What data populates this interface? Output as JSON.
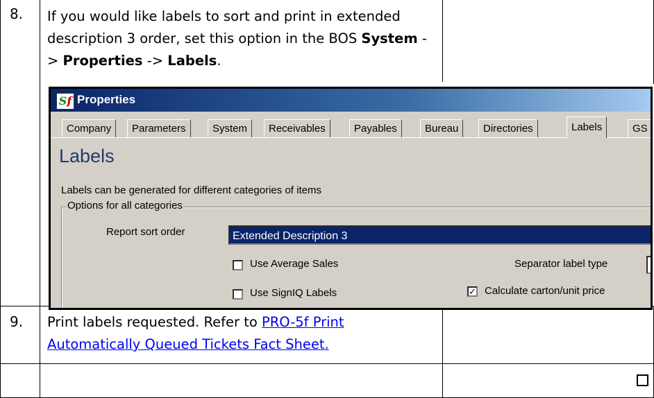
{
  "steps": [
    {
      "number": "8.",
      "text_parts": {
        "intro": "If you would like labels to sort and print in extended description 3 order, set this option in the BOS ",
        "bold_1": "System",
        "sep_1": " -> ",
        "bold_2": "Properties",
        "sep_2": " -> ",
        "bold_3": "Labels",
        "end": "."
      }
    },
    {
      "number": "9.",
      "text": "Print labels requested. Refer to ",
      "link_text": " PRO-5f Print Automatically Queued Tickets Fact Sheet."
    }
  ],
  "footer_checkbox": {
    "checked": false
  },
  "dialog": {
    "title": "Properties",
    "logo": {
      "s": "S",
      "f": "f"
    },
    "tabs": [
      "Company",
      "Parameters",
      "System",
      "Receivables",
      "Payables",
      "Bureau",
      "Directories",
      "Labels",
      "GS"
    ],
    "active_tab": "Labels",
    "heading": "Labels",
    "description": "Labels can be generated for different categories of items",
    "group_title": "Options for all categories",
    "report_sort_label": "Report sort order",
    "report_sort_value": "Extended Description 3",
    "use_average_sales": {
      "label": "Use Average Sales",
      "checked": false
    },
    "separator_label": "Separator label type",
    "use_signiq": {
      "label": "Use SignIQ Labels",
      "checked": false
    },
    "calc_carton": {
      "label": "Calculate carton/unit price",
      "checked": true
    }
  },
  "colors": {
    "title_bar": "#0a246a",
    "heading": "#1f3a6e",
    "selection": "#0a246a",
    "link": "#0000ee",
    "window_bg": "#d4d0c8"
  }
}
